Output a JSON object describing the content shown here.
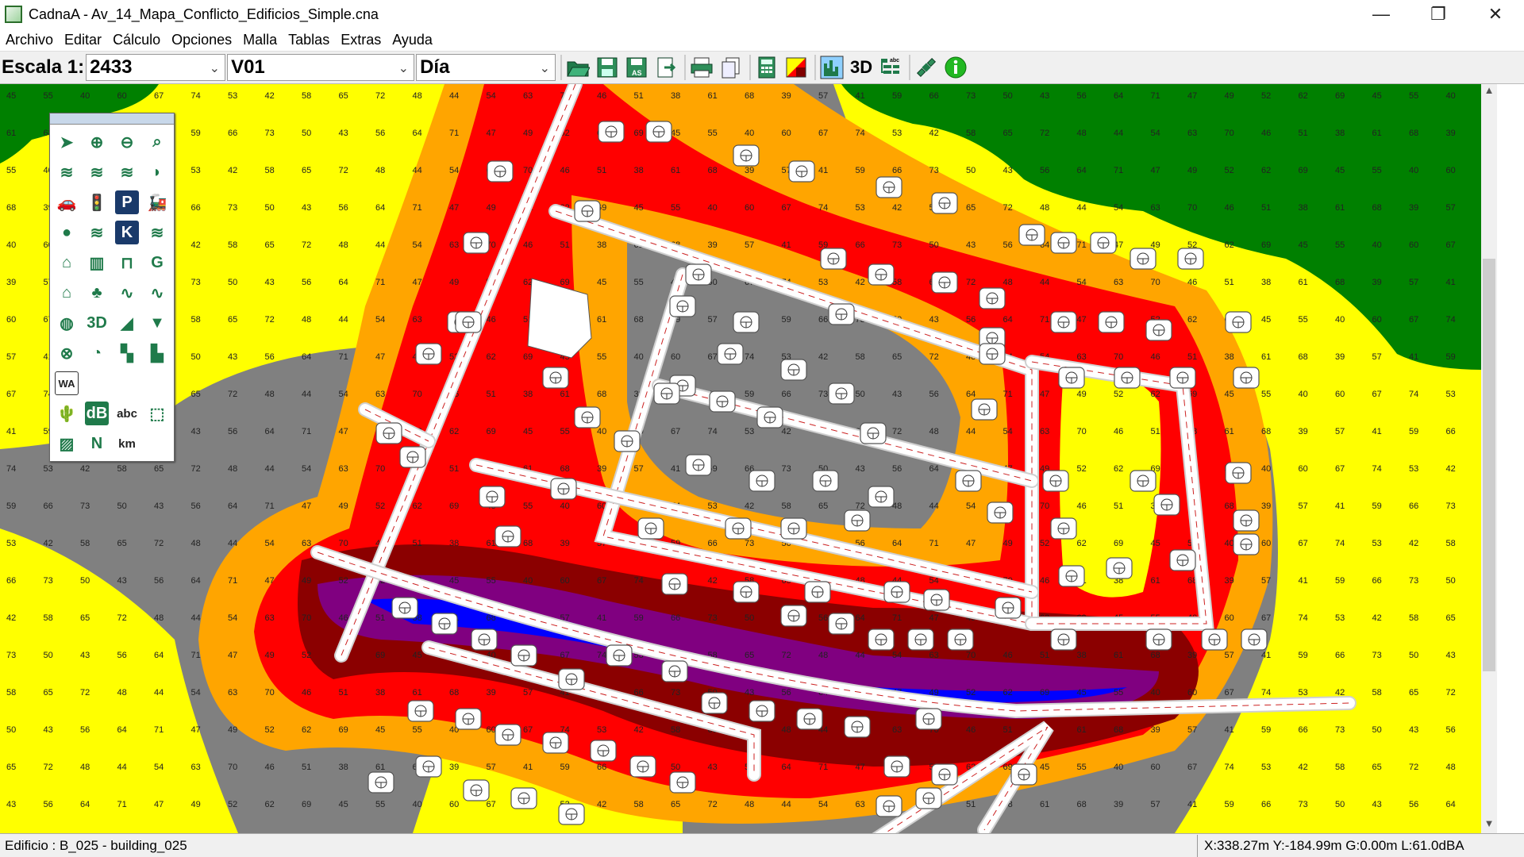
{
  "window": {
    "title": "CadnaA - Av_14_Mapa_Conflicto_Edificios_Simple.cna",
    "minimize": "—",
    "maximize": "❐",
    "close": "✕"
  },
  "menu": [
    "Archivo",
    "Editar",
    "Cálculo",
    "Opciones",
    "Malla",
    "Tablas",
    "Extras",
    "Ayuda"
  ],
  "toolbar": {
    "scale_label": "Escala 1:",
    "scale_value": "2433",
    "variant": "V01",
    "period": "Día",
    "label_3d": "3D",
    "icons": [
      "open-icon",
      "save-icon",
      "save-as-icon",
      "export-icon",
      "print-icon",
      "copy-icon",
      "calculator-icon",
      "grid-color-icon",
      "terrain-icon",
      "3d-icon",
      "label-list-icon",
      "satellite-icon",
      "info-icon"
    ]
  },
  "palette": {
    "tools": [
      {
        "name": "select-arrow-icon",
        "glyph": "➤"
      },
      {
        "name": "zoom-in-icon",
        "glyph": "⊕"
      },
      {
        "name": "zoom-out-icon",
        "glyph": "⊖"
      },
      {
        "name": "zoom-window-icon",
        "glyph": "⌕"
      },
      {
        "name": "point-source-icon",
        "glyph": "≋"
      },
      {
        "name": "line-source-icon",
        "glyph": "≋"
      },
      {
        "name": "area-source-icon",
        "glyph": "≋"
      },
      {
        "name": "vertical-area-source-icon",
        "glyph": "◗"
      },
      {
        "name": "road-icon",
        "glyph": "🚗"
      },
      {
        "name": "traffic-light-icon",
        "glyph": "🚦"
      },
      {
        "name": "parking-icon",
        "glyph": "P"
      },
      {
        "name": "railway-icon",
        "glyph": "🚂"
      },
      {
        "name": "tennis-icon",
        "glyph": "●"
      },
      {
        "name": "industrial-icon",
        "glyph": "≋"
      },
      {
        "name": "k-icon",
        "glyph": "K"
      },
      {
        "name": "vertical-area-icon",
        "glyph": "≋"
      },
      {
        "name": "building-icon",
        "glyph": "⌂"
      },
      {
        "name": "barrier-icon",
        "glyph": "▥"
      },
      {
        "name": "bridge-icon",
        "glyph": "⊓"
      },
      {
        "name": "ground-absorption-icon",
        "glyph": "G"
      },
      {
        "name": "building-evaluation-icon",
        "glyph": "⌂"
      },
      {
        "name": "forest-icon",
        "glyph": "♣"
      },
      {
        "name": "contour-icon",
        "glyph": "∿"
      },
      {
        "name": "height-line-icon",
        "glyph": "∿"
      },
      {
        "name": "cylinder-icon",
        "glyph": "◍"
      },
      {
        "name": "3d-reflector-icon",
        "glyph": "3D"
      },
      {
        "name": "embankment-icon",
        "glyph": "◢"
      },
      {
        "name": "triangle-icon",
        "glyph": "▼"
      },
      {
        "name": "receiver-icon",
        "glyph": "⊗"
      },
      {
        "name": "receiver-points-icon",
        "glyph": "◔"
      },
      {
        "name": "grid-area-icon",
        "glyph": "▚"
      },
      {
        "name": "facade-icon",
        "glyph": "▙"
      },
      {
        "name": "wa-icon",
        "glyph": "WA"
      },
      {
        "name": "empty-slot-1",
        "glyph": ""
      },
      {
        "name": "empty-slot-2",
        "glyph": ""
      },
      {
        "name": "empty-slot-3",
        "glyph": ""
      },
      {
        "name": "terrain-object-icon",
        "glyph": "🌵"
      },
      {
        "name": "db-label-icon",
        "glyph": "dB"
      },
      {
        "name": "text-label-icon",
        "glyph": "abc"
      },
      {
        "name": "selection-rect-icon",
        "glyph": "⬚"
      },
      {
        "name": "hatch-icon",
        "glyph": "▨"
      },
      {
        "name": "north-arrow-icon",
        "glyph": "N"
      },
      {
        "name": "scale-bar-icon",
        "glyph": "km"
      }
    ]
  },
  "map": {
    "colors": {
      "le_45": "#008000",
      "45_50": "#ffff00",
      "50_55": "#808080",
      "55_60": "#ffa500",
      "60_65": "#ff0000",
      "65_70": "#8b0000",
      "70_75": "#800080",
      "75_80": "#0000ff",
      "road": "#ffffff",
      "building": "#ffffff"
    },
    "sample_labels": [
      "45",
      "46",
      "47",
      "48",
      "50",
      "53",
      "57",
      "55",
      "51",
      "49",
      "44",
      "43",
      "42",
      "41",
      "40",
      "38",
      "52",
      "54",
      "56",
      "58",
      "59",
      "60",
      "61",
      "62",
      "63",
      "64",
      "65",
      "66",
      "67",
      "68",
      "69",
      "70",
      "71",
      "72",
      "73",
      "74",
      "39"
    ]
  },
  "status": {
    "left": "Edificio : B_025 - building_025",
    "right": "X:338.27m Y:-184.99m G:0.00m L:61.0dBA"
  }
}
